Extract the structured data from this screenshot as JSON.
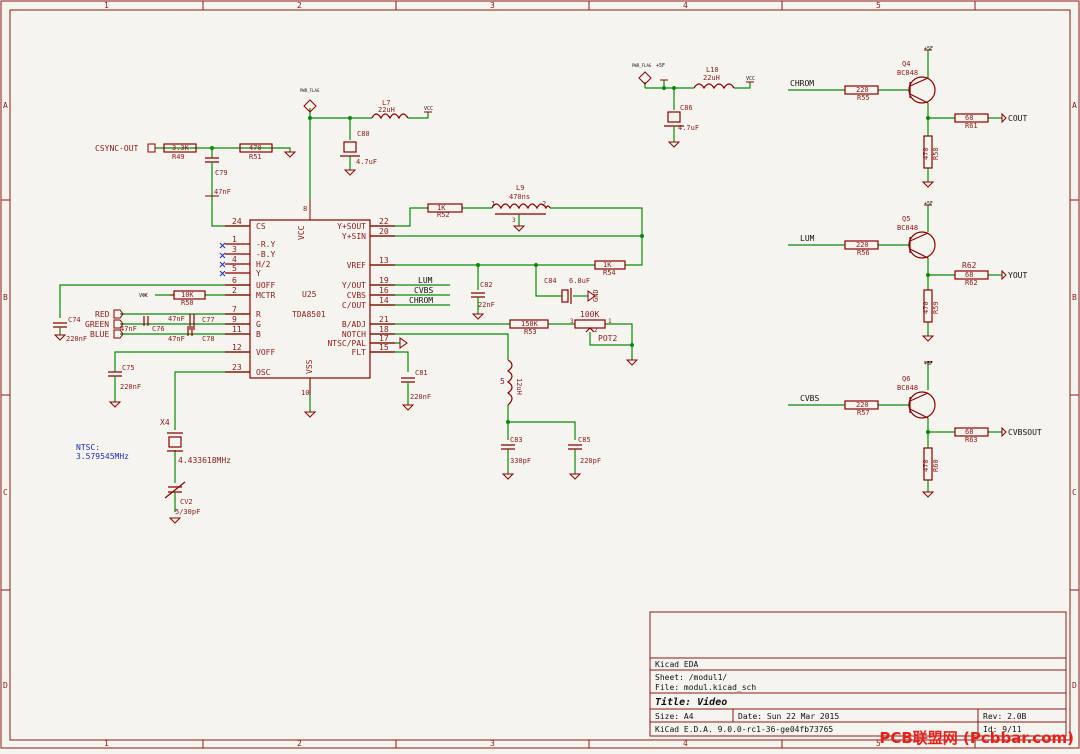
{
  "frame": {
    "cols": [
      "1",
      "2",
      "3",
      "4",
      "5"
    ],
    "rows": [
      "A",
      "B",
      "C",
      "D"
    ]
  },
  "colors": {
    "wire": "#0a8a0a",
    "symbol": "#8b0000",
    "text": "#8b1a1a",
    "label": "#0b0b0b",
    "frame": "#8b1a1a",
    "note": "#1e2fb8",
    "background": "#f5f4ef"
  },
  "title_block": {
    "company": "Kicad EDA",
    "sheet": "Sheet: /modul1/",
    "file": "File: modul.kicad_sch",
    "title": "Title: Video",
    "size": "Size: A4",
    "date": "Date: Sun 22 Mar 2015",
    "rev": "Rev: 2.0B",
    "tool": "KiCad E.D.A. 9.0.0-rc1-36-ge04fb73765",
    "id": "Id: 9/11"
  },
  "watermark": "PCB联盟网 (Pcbbar.com)",
  "ic": {
    "ref": "U25",
    "value": "TDA8501",
    "vcc": "VCC",
    "vss": "VSS",
    "vcc_pin": "8",
    "vss_pin": "10",
    "left_pins": [
      {
        "num": "24",
        "name": "CS"
      },
      {
        "num": "1",
        "name": "-R.Y"
      },
      {
        "num": "3",
        "name": "-B.Y"
      },
      {
        "num": "4",
        "name": "H/2"
      },
      {
        "num": "5",
        "name": "Y"
      },
      {
        "num": "6",
        "name": "UOFF"
      },
      {
        "num": "2",
        "name": "MCTR"
      },
      {
        "num": "7",
        "name": "R"
      },
      {
        "num": "9",
        "name": "G"
      },
      {
        "num": "11",
        "name": "B"
      },
      {
        "num": "12",
        "name": "VOFF"
      },
      {
        "num": "23",
        "name": "OSC"
      }
    ],
    "right_pins": [
      {
        "num": "22",
        "name": "Y+SOUT"
      },
      {
        "num": "20",
        "name": "Y+SIN"
      },
      {
        "num": "13",
        "name": "VREF"
      },
      {
        "num": "19",
        "name": "Y/OUT"
      },
      {
        "num": "16",
        "name": "CVBS"
      },
      {
        "num": "14",
        "name": "C/OUT"
      },
      {
        "num": "21",
        "name": "B/ADJ"
      },
      {
        "num": "18",
        "name": "NOTCH"
      },
      {
        "num": "17",
        "name": "NTSC/PAL"
      },
      {
        "num": "15",
        "name": "FLT"
      }
    ]
  },
  "components": {
    "R49": {
      "ref": "R49",
      "value": "3.3K"
    },
    "R51": {
      "ref": "R51",
      "value": "470"
    },
    "R50": {
      "ref": "R50",
      "value": "10K"
    },
    "R52": {
      "ref": "R52",
      "value": "1K"
    },
    "R54": {
      "ref": "R54",
      "value": "1K"
    },
    "R53": {
      "ref": "R53",
      "value": "150K"
    },
    "POT2": {
      "ref": "POT2",
      "value": "100K",
      "pins": [
        "1",
        "2",
        "3"
      ]
    },
    "C79": {
      "ref": "C79",
      "value": "47nF"
    },
    "C74": {
      "ref": "C74",
      "value": "220nF"
    },
    "C77": {
      "ref": "C77",
      "value": "47nF"
    },
    "C76": {
      "ref": "C76",
      "value": "47nF"
    },
    "C78": {
      "ref": "C78",
      "value": "47nF"
    },
    "C75": {
      "ref": "C75",
      "value": "220nF"
    },
    "C80": {
      "ref": "C80",
      "value": "4.7uF"
    },
    "C81": {
      "ref": "C81",
      "value": "220nF"
    },
    "C82": {
      "ref": "C82",
      "value": "22nF"
    },
    "C83": {
      "ref": "C83",
      "value": "330pF"
    },
    "C84": {
      "ref": "C84",
      "value": "6.8uF"
    },
    "C85": {
      "ref": "C85",
      "value": "220pF"
    },
    "C86": {
      "ref": "C86",
      "value": "4.7uF"
    },
    "L7": {
      "ref": "L7",
      "value": "22uH"
    },
    "L9": {
      "ref": "L9",
      "value": "470ns",
      "pins": [
        "1",
        "2"
      ],
      "pin3": "3"
    },
    "L10": {
      "ref": "L10",
      "value": "22uH"
    },
    "L5": {
      "ref": "5",
      "value": "12uH"
    },
    "X4": {
      "ref": "X4",
      "value": "4.433618MHz"
    },
    "CV2": {
      "ref": "CV2",
      "value": "5/30pF"
    },
    "note": [
      "NTSC:",
      "3.579545MHz"
    ]
  },
  "labels": {
    "csync": "CSYNC-OUT",
    "red": "RED",
    "green": "GREEN",
    "blue": "BLUE",
    "vcc": "VCC",
    "pwr_flag": "PWR_FLAG",
    "gnd": "GND",
    "plus5": "+5F",
    "lum": "LUM",
    "cvbs": "CVBS",
    "chrom": "CHROM"
  },
  "outputs": [
    {
      "in_label": "CHROM",
      "q": "Q4",
      "qval": "BC848",
      "rb_val": "220",
      "rb_ref": "R55",
      "re_val": "470",
      "re_ref": "R58",
      "ro_val": "68",
      "ro_ref": "R61",
      "out": "COUT"
    },
    {
      "in_label": "LUM",
      "q": "Q5",
      "qval": "BC848",
      "rb_val": "220",
      "rb_ref": "R56",
      "re_val": "470",
      "re_ref": "R59",
      "ro_val": "68",
      "ro_ref": "R62",
      "out": "YOUT"
    },
    {
      "in_label": "CVBS",
      "q": "Q6",
      "qval": "BC848",
      "rb_val": "220",
      "rb_ref": "R57",
      "re_val": "470",
      "re_ref": "R60",
      "ro_val": "68",
      "ro_ref": "R63",
      "out": "CVBSOUT"
    }
  ]
}
